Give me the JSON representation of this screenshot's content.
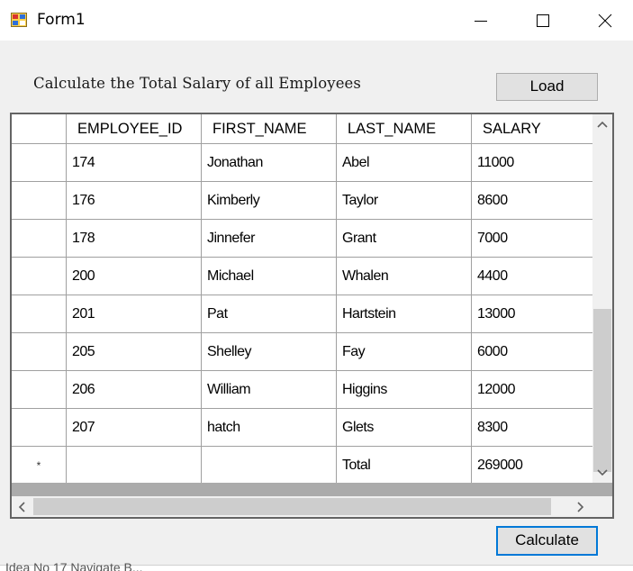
{
  "window": {
    "title": "Form1",
    "icon": "form-app-icon",
    "controls": [
      "minimize-icon",
      "maximize-icon",
      "close-icon"
    ]
  },
  "form": {
    "heading": "Calculate the Total Salary of all Employees",
    "load_label": "Load",
    "calculate_label": "Calculate"
  },
  "grid": {
    "columns": [
      "EMPLOYEE_ID",
      "FIRST_NAME",
      "LAST_NAME",
      "SALARY"
    ],
    "rows": [
      {
        "marker": "",
        "employee_id": "174",
        "first_name": "Jonathan",
        "last_name": "Abel",
        "salary": "11000"
      },
      {
        "marker": "",
        "employee_id": "176",
        "first_name": "Kimberly",
        "last_name": "Taylor",
        "salary": "8600"
      },
      {
        "marker": "",
        "employee_id": "178",
        "first_name": "Jinnefer",
        "last_name": "Grant",
        "salary": "7000"
      },
      {
        "marker": "",
        "employee_id": "200",
        "first_name": "Michael",
        "last_name": "Whalen",
        "salary": "4400"
      },
      {
        "marker": "",
        "employee_id": "201",
        "first_name": "Pat",
        "last_name": "Hartstein",
        "salary": "13000"
      },
      {
        "marker": "",
        "employee_id": "205",
        "first_name": "Shelley",
        "last_name": "Fay",
        "salary": "6000"
      },
      {
        "marker": "",
        "employee_id": "206",
        "first_name": "William",
        "last_name": "Higgins",
        "salary": "12000"
      },
      {
        "marker": "",
        "employee_id": "207",
        "first_name": "hatch",
        "last_name": "Glets",
        "salary": "8300"
      },
      {
        "marker": "*",
        "employee_id": "",
        "first_name": "",
        "last_name": "Total",
        "salary": "269000"
      }
    ]
  },
  "background_text": "Idea No 17 Navigate B..."
}
